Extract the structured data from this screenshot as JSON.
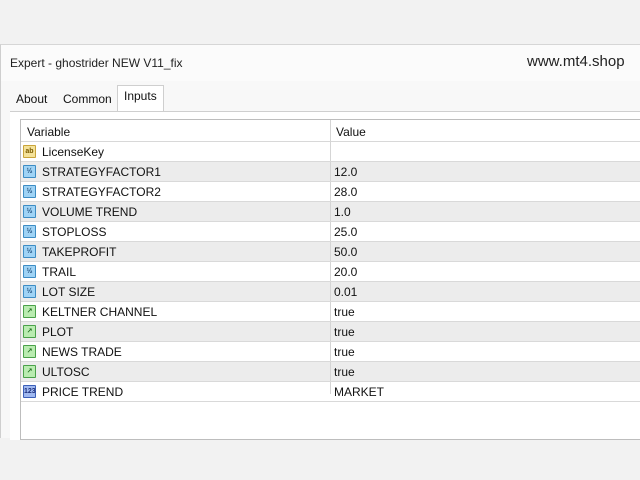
{
  "window": {
    "title": "Expert - ghostrider NEW V11_fix",
    "watermark": "www.mt4.shop"
  },
  "tabs": [
    {
      "label": "About",
      "active": false
    },
    {
      "label": "Common",
      "active": false
    },
    {
      "label": "Inputs",
      "active": true
    }
  ],
  "grid": {
    "columns": [
      "Variable",
      "Value"
    ],
    "rows": [
      {
        "icon": "string-icon",
        "glyph": "ab",
        "variable": "LicenseKey",
        "value": ""
      },
      {
        "icon": "number-icon",
        "glyph": "½",
        "variable": "STRATEGYFACTOR1",
        "value": "12.0"
      },
      {
        "icon": "number-icon",
        "glyph": "½",
        "variable": "STRATEGYFACTOR2",
        "value": "28.0"
      },
      {
        "icon": "number-icon",
        "glyph": "½",
        "variable": "VOLUME TREND",
        "value": "1.0"
      },
      {
        "icon": "number-icon",
        "glyph": "½",
        "variable": "STOPLOSS",
        "value": "25.0"
      },
      {
        "icon": "number-icon",
        "glyph": "½",
        "variable": "TAKEPROFIT",
        "value": "50.0"
      },
      {
        "icon": "number-icon",
        "glyph": "½",
        "variable": "TRAIL",
        "value": "20.0"
      },
      {
        "icon": "number-icon",
        "glyph": "½",
        "variable": "LOT SIZE",
        "value": "0.01"
      },
      {
        "icon": "bool-icon",
        "glyph": "↗",
        "variable": "KELTNER CHANNEL",
        "value": "true"
      },
      {
        "icon": "bool-icon",
        "glyph": "↗",
        "variable": "PLOT",
        "value": "true"
      },
      {
        "icon": "bool-icon",
        "glyph": "↗",
        "variable": "NEWS TRADE",
        "value": "true"
      },
      {
        "icon": "bool-icon",
        "glyph": "↗",
        "variable": "ULTOSC",
        "value": "true"
      },
      {
        "icon": "enum-icon",
        "glyph": "123",
        "variable": "PRICE TREND",
        "value": "MARKET"
      }
    ]
  }
}
